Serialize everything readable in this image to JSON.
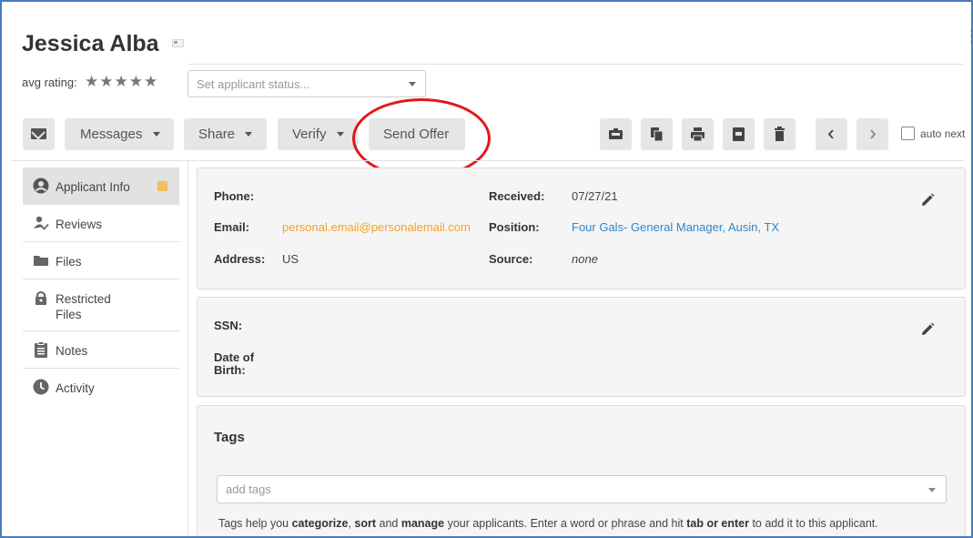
{
  "applicant": {
    "name": "Jessica Alba",
    "rating_label": "avg rating:",
    "stars": "★★★★★",
    "status_placeholder": "Set applicant status..."
  },
  "toolbar": {
    "messages": "Messages",
    "share": "Share",
    "verify": "Verify",
    "send_offer": "Send Offer",
    "auto_next": "auto next"
  },
  "sidebar": {
    "items": [
      {
        "label": "Applicant Info",
        "icon": "user-circle-icon"
      },
      {
        "label": "Reviews",
        "icon": "user-check-icon"
      },
      {
        "label": "Files",
        "icon": "folder-icon"
      },
      {
        "label": "Restricted Files",
        "icon": "lock-icon"
      },
      {
        "label": "Notes",
        "icon": "clipboard-icon"
      },
      {
        "label": "Activity",
        "icon": "clock-icon"
      }
    ]
  },
  "info": {
    "phone_label": "Phone:",
    "phone_value": "",
    "email_label": "Email:",
    "email_value": "personal.email@personalemail.com",
    "address_label": "Address:",
    "address_value": "US",
    "received_label": "Received:",
    "received_value": "07/27/21",
    "position_label": "Position:",
    "position_value": "Four Gals- General Manager, Ausin, TX",
    "source_label": "Source:",
    "source_value": "none"
  },
  "private": {
    "ssn_label": "SSN:",
    "dob_label": "Date of Birth:"
  },
  "tags": {
    "title": "Tags",
    "placeholder": "add tags",
    "help_1": "Tags help you ",
    "help_b1": "categorize",
    "help_2": ", ",
    "help_b2": "sort",
    "help_3": " and ",
    "help_b3": "manage",
    "help_4": " your applicants. Enter a word or phrase and hit ",
    "help_b4": "tab or enter",
    "help_5": " to add it to this applicant."
  },
  "colors": {
    "accent_blue": "#2f86c7",
    "email_orange": "#f0a326",
    "highlight_red": "#e01818",
    "badge": "#f2bf5e"
  }
}
